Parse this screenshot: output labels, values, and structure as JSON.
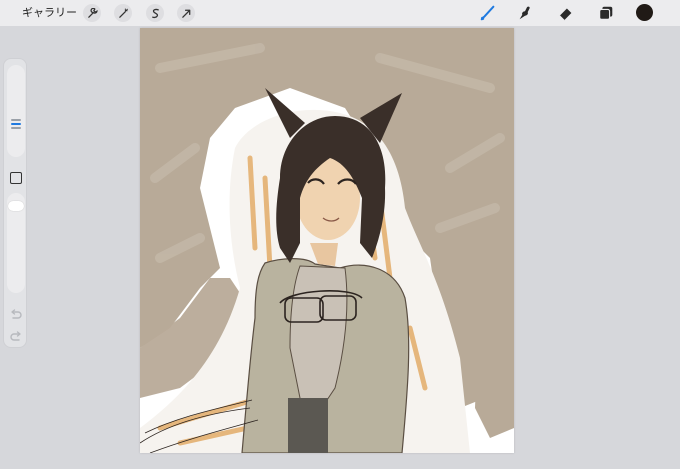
{
  "topbar": {
    "gallery_label": "ギャラリー",
    "left_tools": [
      {
        "name": "wrench-icon"
      },
      {
        "name": "magic-wand-icon"
      },
      {
        "name": "selection-icon"
      },
      {
        "name": "transform-arrow-icon"
      }
    ],
    "right_tools": [
      {
        "name": "brush-icon",
        "active": true,
        "color": "#1f7ae0"
      },
      {
        "name": "smudge-icon"
      },
      {
        "name": "eraser-icon"
      },
      {
        "name": "layers-icon"
      }
    ],
    "current_color": "#201a16"
  },
  "sidebar": {
    "brush_size_indicator": "size",
    "modify_icon": "square-icon",
    "undo_icon": "undo-icon",
    "redo_icon": "redo-icon"
  },
  "canvas": {
    "background_color": "#ffffff",
    "paint_colors": {
      "background_wash": "#b8aa98",
      "hair": "#3a2f29",
      "orange_sketch": "#e2a860",
      "coat": "#b9b39f",
      "shirt": "#c9c1b6",
      "skin": "#f0d3b0",
      "line": "#2c2420"
    }
  }
}
